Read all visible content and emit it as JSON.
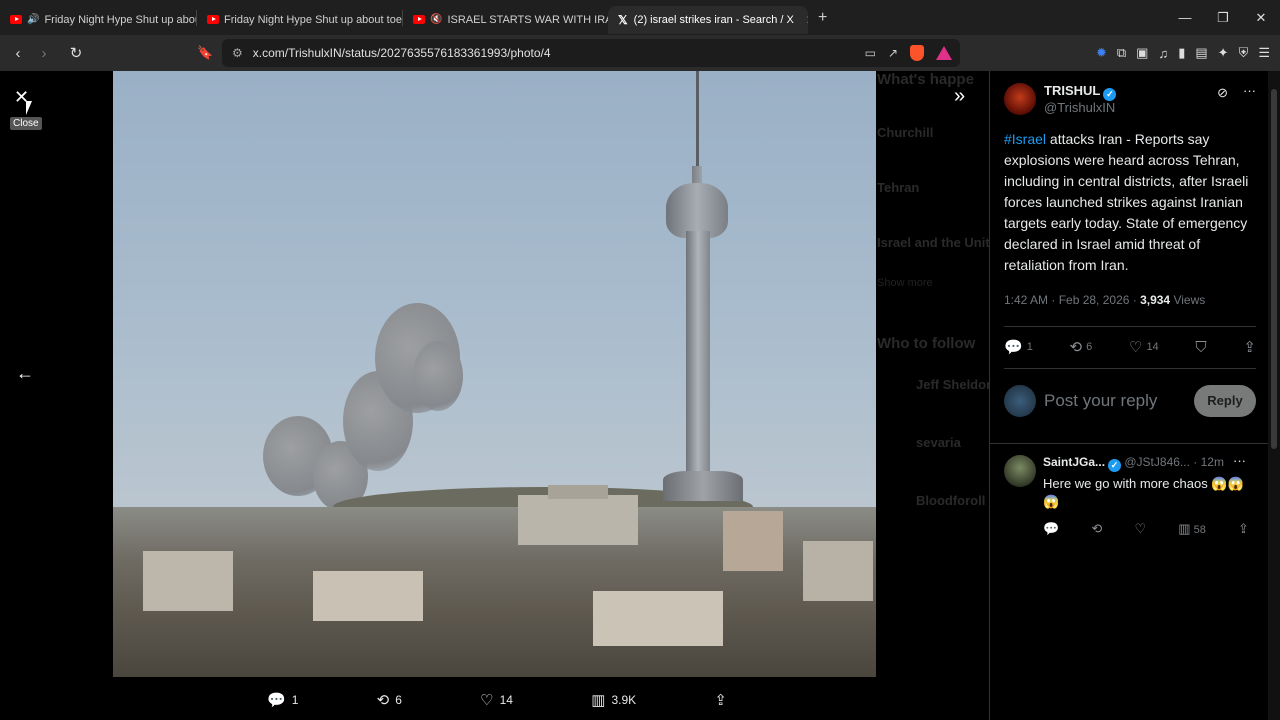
{
  "tabs": [
    {
      "title": "Friday Night Hype Shut up about",
      "icon": "youtube-icon",
      "audio": true,
      "active": false
    },
    {
      "title": "Friday Night Hype Shut up about toe",
      "icon": "youtube-icon",
      "audio": false,
      "active": false
    },
    {
      "title": "ISRAEL STARTS WAR WITH IRAN,",
      "icon": "youtube-icon",
      "muted": true,
      "active": false
    },
    {
      "title": "(2) israel strikes iran - Search / X",
      "icon": "x-logo-icon",
      "active": true
    }
  ],
  "address": {
    "url": "x.com/TrishulxIN/status/2027635576183361993/photo/4"
  },
  "viewer": {
    "close_tooltip": "Close"
  },
  "photo_actions": {
    "replies": "1",
    "reposts": "6",
    "likes": "14",
    "views": "3.9K"
  },
  "tweet": {
    "author_name": "TRISHUL",
    "author_handle": "@TrishulxIN",
    "hashtag": "#Israel",
    "text": " attacks Iran - Reports say explosions were heard across Tehran, including in central districts, after Israeli forces launched strikes against Iranian targets early today. State of emergency declared in Israel amid threat of retaliation from Iran.",
    "time": "1:42 AM · Feb 28, 2026 · ",
    "views_count": "3,934",
    "views_label": " Views",
    "replies": "1",
    "reposts": "6",
    "likes": "14"
  },
  "reply_box": {
    "placeholder": "Post your reply",
    "button": "Reply"
  },
  "comment": {
    "name": "SaintJGa...",
    "handle": "@JStJ846...",
    "time": "· 12m",
    "text": "Here we go with more chaos 😱😱😱",
    "views": "58"
  },
  "background": {
    "heading1": "What's happe",
    "item1": "Churchill",
    "item2": "Tehran",
    "item3": "Israel and the Unit",
    "show_more": "Show more",
    "heading2": "Who to follow",
    "person1": "Jeff Sheldon",
    "person2": "sevaria",
    "person3": "Bloodforoll"
  }
}
